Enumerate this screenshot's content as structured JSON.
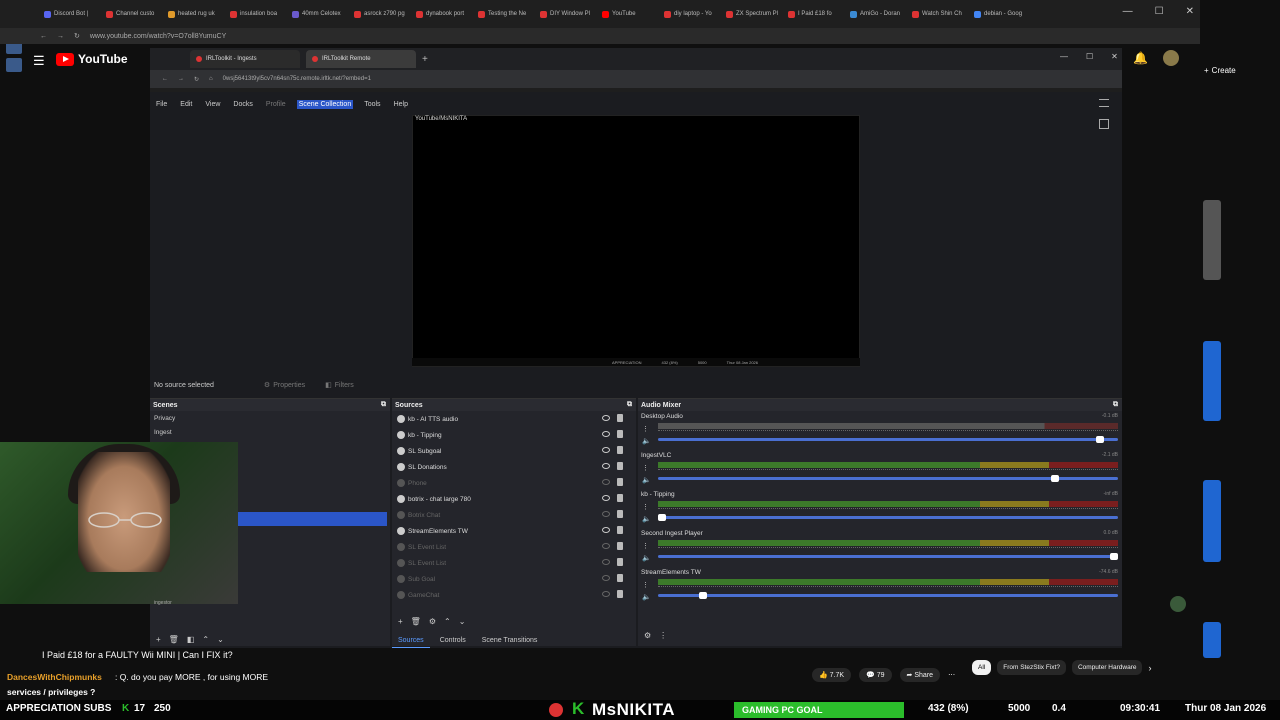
{
  "outer_browser": {
    "tabs": [
      "Discord Bot |",
      "Channel custo",
      "heated rug uk",
      "insulation boa",
      "40mm Celotex",
      "asrock z790 pg",
      "dynabook port",
      "Testing the Ne",
      "DIY Window Pl",
      "YouTube",
      "diy laptop - Yo",
      "ZX Spectrum Pl",
      "I Paid £18 fo",
      "AmiGo - Doran",
      "Watch Shin Ch",
      "debian - Goog"
    ],
    "url": "www.youtube.com/watch?v=O7oll8YumuCY"
  },
  "youtube": {
    "logo_text": "YouTube",
    "create_label": "Create",
    "video_title": "I Paid £18 for a FAULTY Wii MINI | Can I FIX it?",
    "likes": "7.7K",
    "dislikes": "79",
    "share_label": "Share",
    "chips": [
      "All",
      "From StezStix Fixt?",
      "Computer Hardware"
    ]
  },
  "inner_browser": {
    "tabs": [
      "IRLToolkit - Ingests",
      "IRLToolkit Remote"
    ],
    "url": "0wsj56413t9yl5cv7n64sn75c.remote.irltk.net/?embed=1"
  },
  "obs": {
    "menu": [
      "File",
      "Edit",
      "View",
      "Docks",
      "Profile",
      "Scene Collection",
      "Tools",
      "Help"
    ],
    "selected_menu": "Scene Collection",
    "preview_label": "YouTube/MsNIKITA",
    "preview_ticker": [
      "APPRECIATION",
      "432 (8%)",
      "5000",
      "Thur 08 Jan 2026"
    ],
    "source_status": "No source selected",
    "properties_label": "Properties",
    "filters_label": "Filters",
    "scenes_title": "Scenes",
    "scenes": [
      "Privacy",
      "Ingest"
    ],
    "sources_title": "Sources",
    "sources": [
      {
        "name": "kb - AI TTS audio",
        "dim": false
      },
      {
        "name": "kb - Tipping",
        "dim": false
      },
      {
        "name": "SL Subgoal",
        "dim": false
      },
      {
        "name": "SL Donations",
        "dim": false
      },
      {
        "name": "Phone",
        "dim": true
      },
      {
        "name": "botrix - chat large 780",
        "dim": false
      },
      {
        "name": "Botrix Chat",
        "dim": true
      },
      {
        "name": "StreamElements TW",
        "dim": false
      },
      {
        "name": "SL Event List",
        "dim": true
      },
      {
        "name": "SL Event List",
        "dim": true
      },
      {
        "name": "Sub Goal",
        "dim": true
      },
      {
        "name": "GameChat",
        "dim": true
      }
    ],
    "bottom_tabs": [
      "Sources",
      "Controls",
      "Scene Transitions"
    ],
    "mixer_title": "Audio Mixer",
    "mixer": [
      {
        "name": "Desktop Audio",
        "db": "-0.1 dB",
        "level": 0.97,
        "quiet": true
      },
      {
        "name": "IngestVLC",
        "db": "-2.1 dB",
        "level": 0.87,
        "quiet": false
      },
      {
        "name": "kb - Tipping",
        "db": "-inf dB",
        "level": 0.0,
        "quiet": false
      },
      {
        "name": "Second Ingest Player",
        "db": "0.0 dB",
        "level": 1.0,
        "quiet": false
      },
      {
        "name": "StreamElements TW",
        "db": "-74.6 dB",
        "level": 0.09,
        "quiet": false
      }
    ]
  },
  "webcam_label": "ingestor",
  "chat": {
    "name": "DancesWithChipmunks",
    "message": ": Q. do you pay MORE , for using MORE",
    "message2": "services / privileges ?"
  },
  "ticker": {
    "left": "APPRECIATION SUBS",
    "subs": "17",
    "count": "250",
    "channel": "MsNIKITA",
    "goal": "GAMING PC GOAL",
    "goal_value": "432 (8%)",
    "goal_target": "5000",
    "time": "09:30:41",
    "prefix": "0.4",
    "date": "Thur 08 Jan 2026"
  },
  "colors": {
    "accent": "#2b56c8",
    "youtube_red": "#ff0000",
    "goal_green": "#2bbd2b"
  }
}
